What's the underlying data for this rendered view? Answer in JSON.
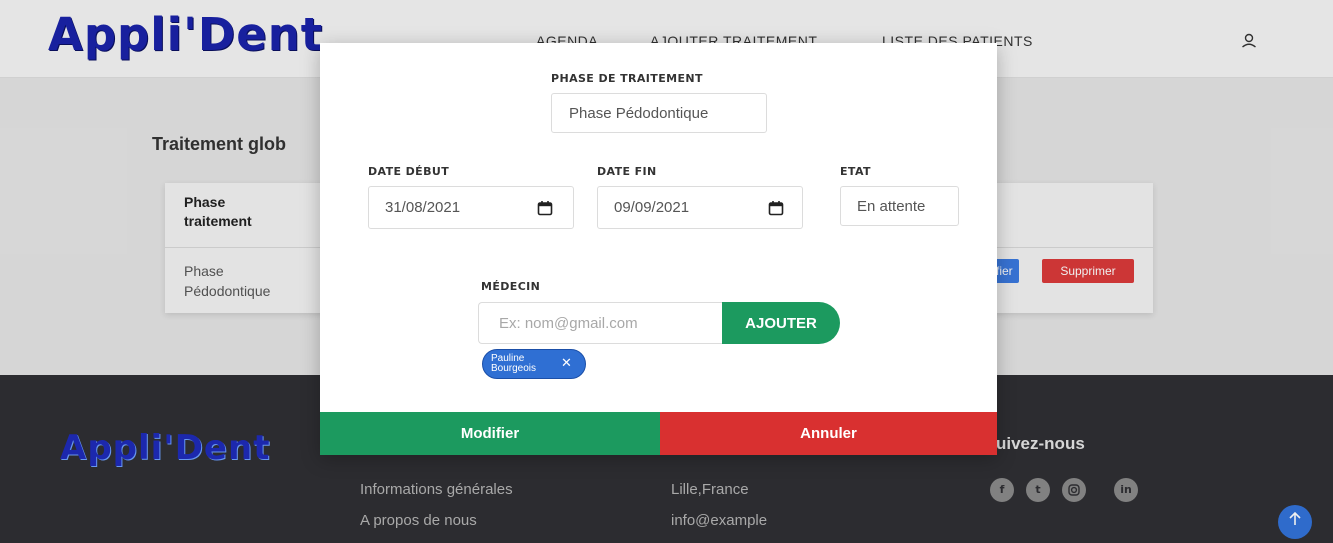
{
  "header": {
    "logo": "Appli'Dent",
    "nav": [
      "AGENDA",
      "AJOUTER TRAITEMENT",
      "LISTE DES PATIENTS"
    ],
    "user_icon": "user-icon"
  },
  "main": {
    "title": "Traitement glob",
    "table": {
      "header_phase": "Phase traitement",
      "row_phase": "Phase Pédodontique",
      "edit_label": "fier",
      "delete_label": "Supprimer"
    }
  },
  "footer": {
    "logo": "Appli'Dent",
    "links_col1": [
      "Informations générales",
      "A propos de nous"
    ],
    "links_col2": [
      "Lille,France",
      "info@example"
    ],
    "follow_title": "uivez-nous",
    "social_icons": [
      "facebook-icon",
      "twitter-icon",
      "instagram-icon",
      "linkedin-icon"
    ],
    "scroll_top_icon": "arrow-up-icon"
  },
  "modal": {
    "phase_label": "PHASE DE TRAITEMENT",
    "phase_value": "Phase Pédodontique",
    "date_debut_label": "DATE DÉBUT",
    "date_debut_value": "31/08/2021",
    "date_fin_label": "DATE FIN",
    "date_fin_value": "09/09/2021",
    "etat_label": "ETAT",
    "etat_value": "En attente",
    "medecin_label": "MÉDECIN",
    "email_placeholder": "Ex: nom@gmail.com",
    "add_label": "AJOUTER",
    "chip_label": "Pauline Bourgeois",
    "modify_label": "Modifier",
    "cancel_label": "Annuler"
  },
  "colors": {
    "brand": "#1a23a8",
    "success": "#1c9a5f",
    "danger": "#d93030",
    "primary": "#3272d8"
  }
}
